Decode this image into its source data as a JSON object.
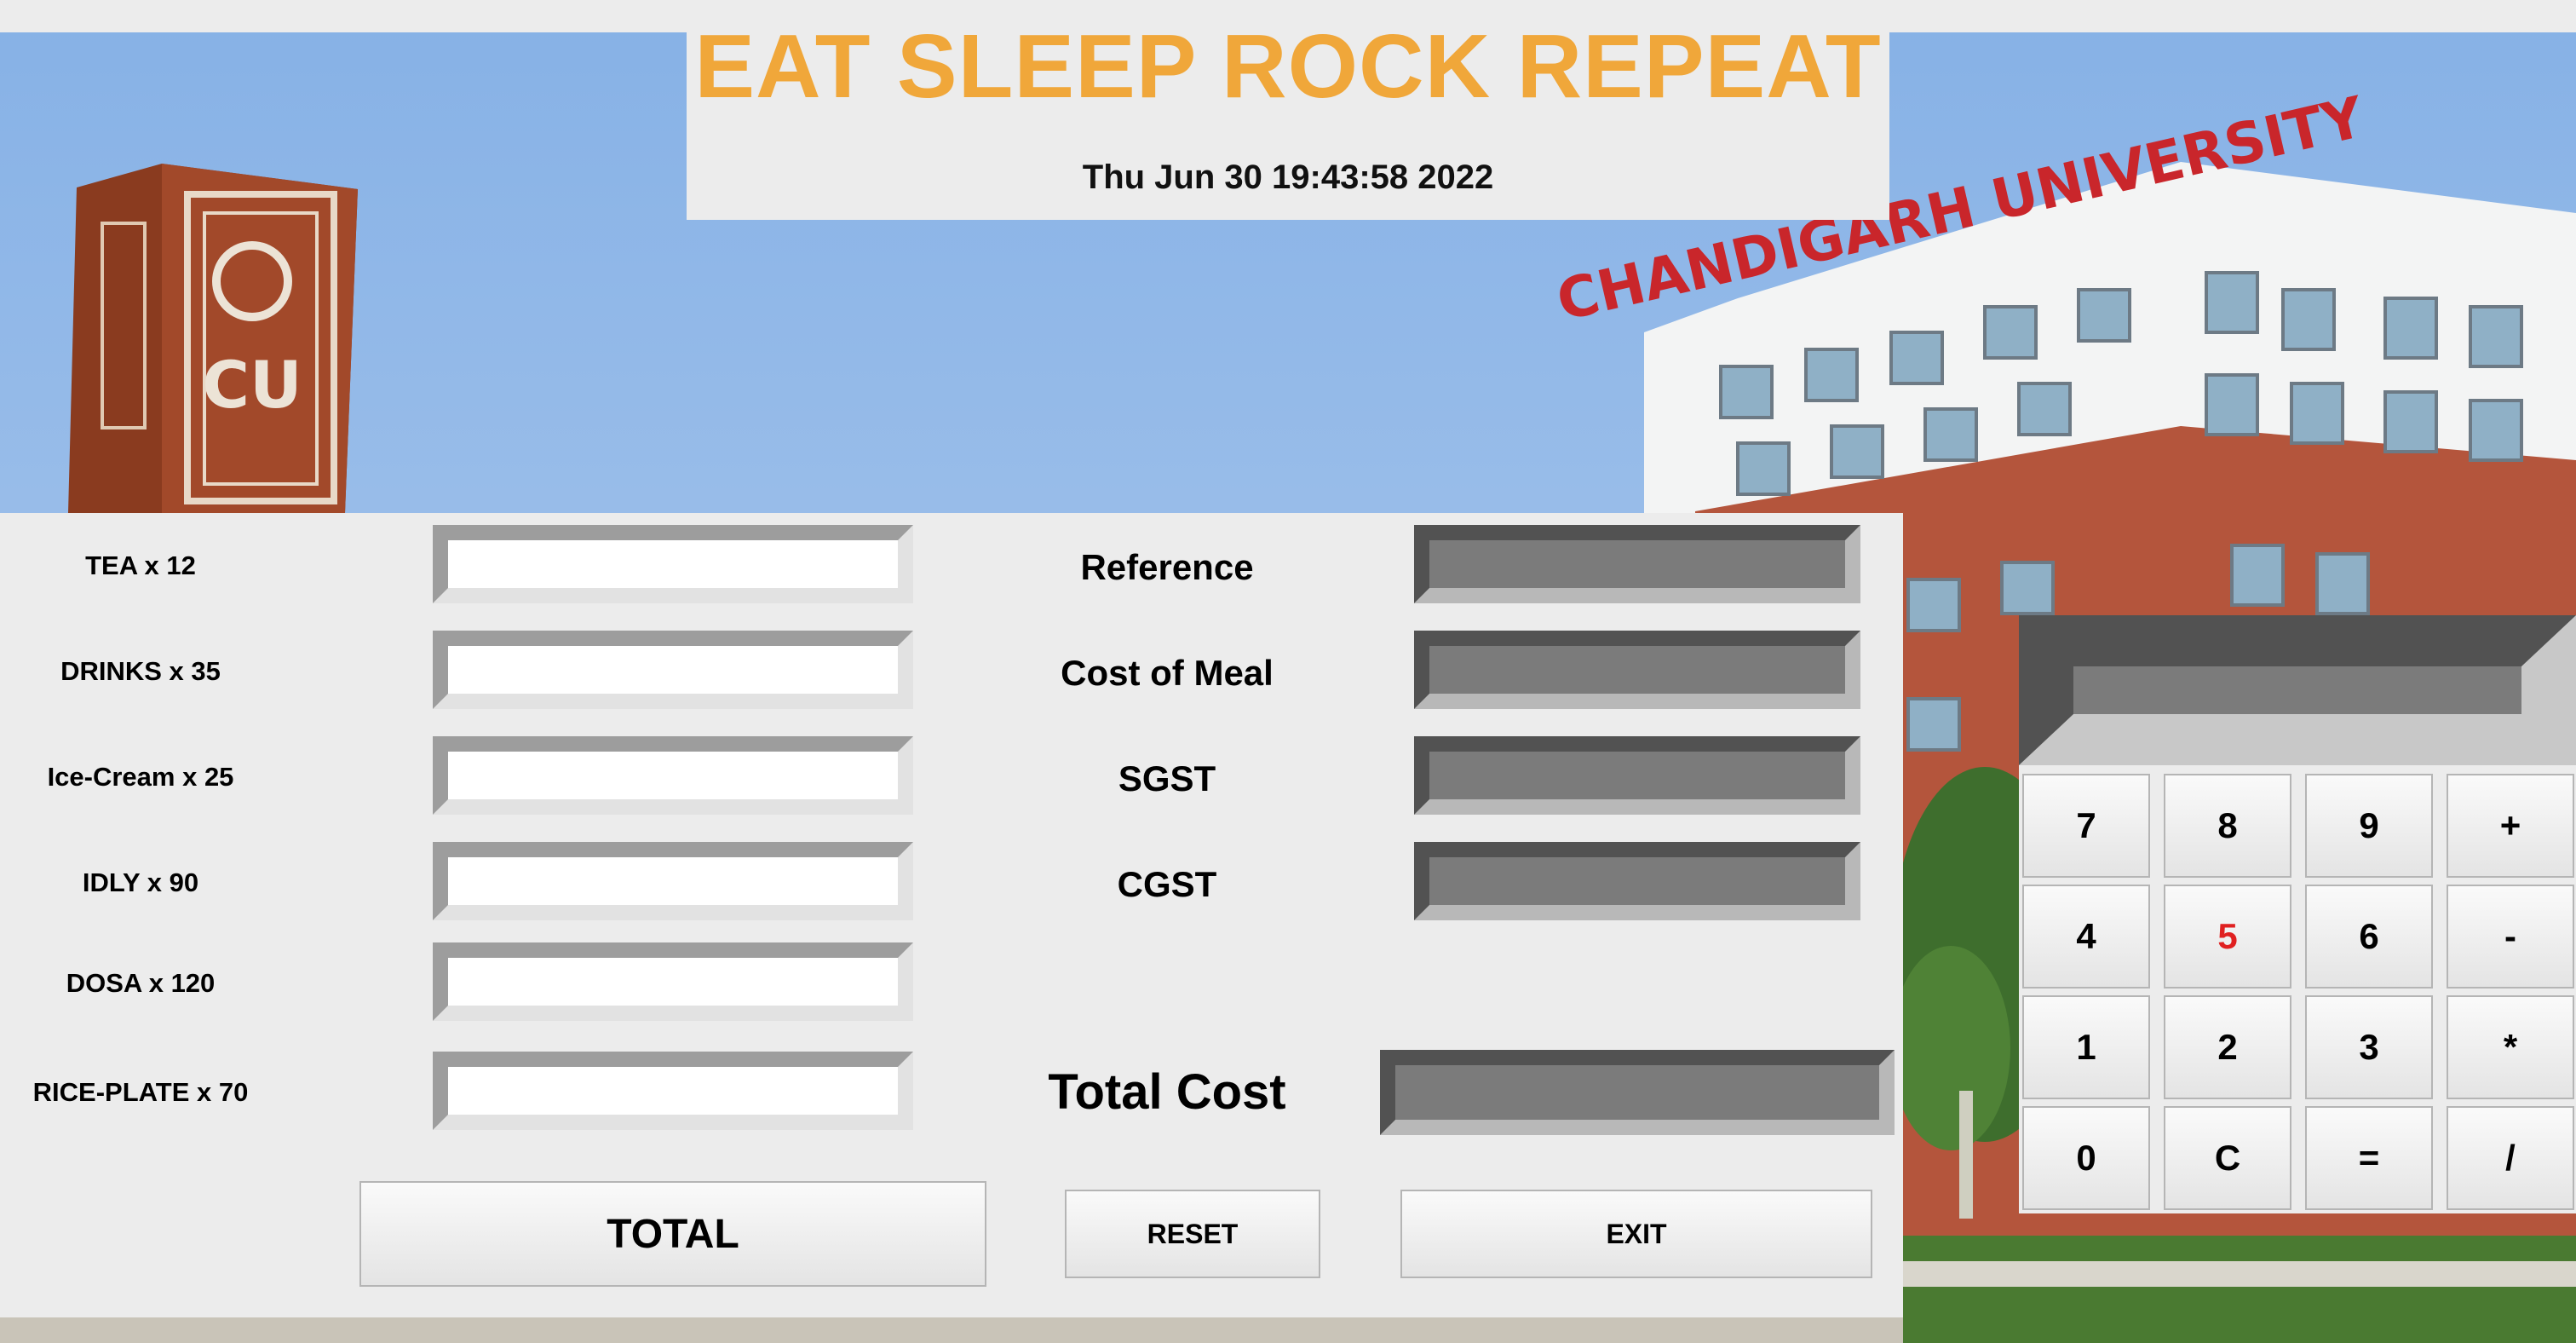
{
  "header": {
    "title": "EAT SLEEP ROCK REPEAT",
    "datetime": "Thu Jun 30 19:43:58 2022"
  },
  "background": {
    "sign_text": "CHANDIGARH UNIVERSITY",
    "pillar_text": "CU"
  },
  "items": [
    {
      "label": "TEA x 12",
      "value": ""
    },
    {
      "label": "DRINKS x 35",
      "value": ""
    },
    {
      "label": "Ice-Cream x 25",
      "value": ""
    },
    {
      "label": "IDLY x 90",
      "value": ""
    },
    {
      "label": "DOSA x 120",
      "value": ""
    },
    {
      "label": "RICE-PLATE x 70",
      "value": ""
    }
  ],
  "summary": {
    "reference": {
      "label": "Reference",
      "value": ""
    },
    "cost_of_meal": {
      "label": "Cost of Meal",
      "value": ""
    },
    "sgst": {
      "label": "SGST",
      "value": ""
    },
    "cgst": {
      "label": "CGST",
      "value": ""
    },
    "total_cost": {
      "label": "Total Cost",
      "value": ""
    }
  },
  "buttons": {
    "total": "TOTAL",
    "reset": "RESET",
    "exit": "EXIT"
  },
  "calculator": {
    "display": "",
    "keys": [
      "7",
      "8",
      "9",
      "+",
      "4",
      "5",
      "6",
      "-",
      "1",
      "2",
      "3",
      "*",
      "0",
      "C",
      "=",
      "/"
    ],
    "highlight_key_color": "#e02020"
  },
  "colors": {
    "title": "#f0a73a",
    "panel": "#ececec",
    "sky": "#9bbce3"
  }
}
